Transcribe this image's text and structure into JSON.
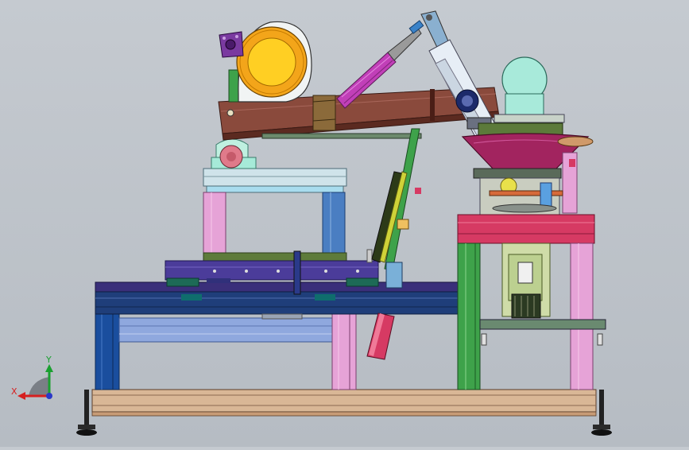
{
  "triad": {
    "x_label": "X",
    "y_label": "Y"
  },
  "colors": {
    "background": "#bcc1c8",
    "frame_blue": "#1a4e9e",
    "frame_pink": "#e6a3d7",
    "frame_green": "#3ea24a",
    "beam_brown": "#8a4a3c",
    "bowl_magenta": "#a2245f",
    "drum_orange": "#f3a51a",
    "motor_cyan": "#a8eada",
    "base_tan": "#d9b796",
    "table_red": "#d63a63",
    "sled_indigo": "#4b3c9a"
  }
}
